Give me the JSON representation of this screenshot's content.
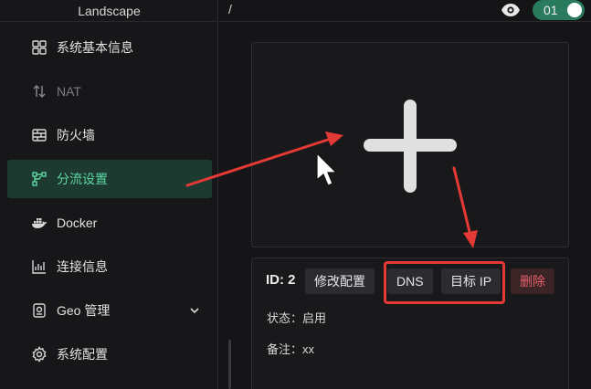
{
  "app": {
    "brand": "Landscape"
  },
  "header": {
    "breadcrumb": "/",
    "toggle_label": "01"
  },
  "sidebar": {
    "items": [
      {
        "label": "系统基本信息",
        "icon": "dashboard-icon"
      },
      {
        "label": "NAT",
        "icon": "updown-arrows-icon",
        "disabled": true
      },
      {
        "label": "防火墙",
        "icon": "firewall-icon"
      },
      {
        "label": "分流设置",
        "icon": "flow-split-icon",
        "active": true
      },
      {
        "label": "Docker",
        "icon": "docker-icon"
      },
      {
        "label": "连接信息",
        "icon": "chart-icon"
      },
      {
        "label": "Geo 管理",
        "icon": "geo-icon",
        "expandable": true
      },
      {
        "label": "系统配置",
        "icon": "gear-icon"
      }
    ]
  },
  "main": {
    "add_card": {
      "icon": "plus-icon"
    },
    "rule": {
      "id_label": "ID: 2",
      "edit_button": "修改配置",
      "dns_button": "DNS",
      "target_ip_button": "目标 IP",
      "delete_button": "删除",
      "status": "状态：启用",
      "note": "备注：xx"
    }
  },
  "colors": {
    "accent": "#5fd6a5",
    "active_bg": "#1c3a30",
    "toggle": "#2a7a5e",
    "danger": "#e5606a",
    "annotation": "#e53935"
  }
}
